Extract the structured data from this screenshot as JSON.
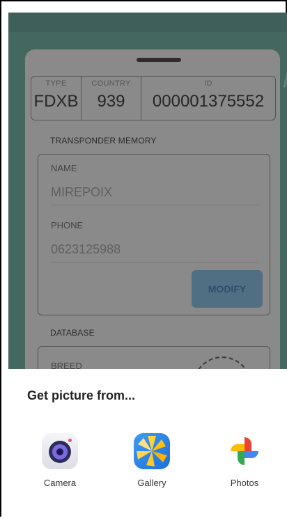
{
  "background_card": {
    "id_table": {
      "type_label": "TYPE",
      "type_value": "FDXB",
      "country_label": "COUNTRY",
      "country_value": "939",
      "id_label": "ID",
      "id_value": "000001375552"
    },
    "memory_section_label": "TRANSPONDER MEMORY",
    "name_label": "NAME",
    "name_value": "MIREPOIX",
    "phone_label": "PHONE",
    "phone_value": "0623125988",
    "modify_label": "MODIFY",
    "database_section_label": "DATABASE",
    "breed_label": "BREED"
  },
  "sheet": {
    "title": "Get picture from...",
    "apps": [
      {
        "label": "Camera",
        "icon": "camera-app-icon"
      },
      {
        "label": "Gallery",
        "icon": "gallery-app-icon"
      },
      {
        "label": "Photos",
        "icon": "photos-pinwheel-icon"
      }
    ]
  },
  "colors": {
    "scrim": "#44675f",
    "card": "#8a8a8a",
    "modify_button": "#516f83",
    "sheet": "#ffffff"
  }
}
